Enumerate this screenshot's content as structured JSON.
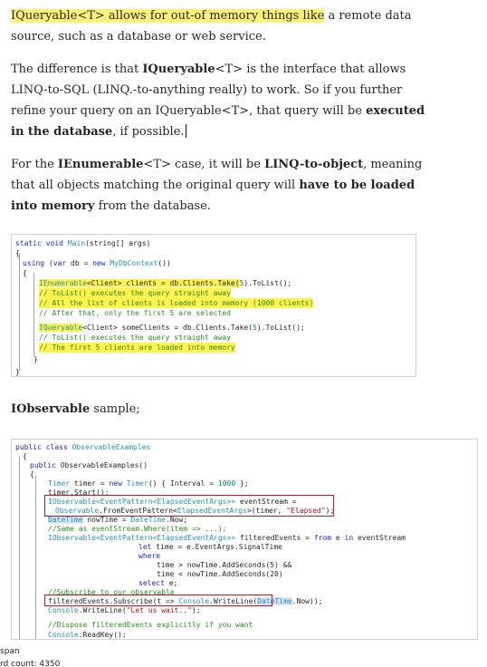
{
  "answer": {
    "p1": {
      "highlight": "IQueryable<T> allows for out-of memory things like",
      "rest": " a remote data source, such as a database or web service."
    },
    "p2": {
      "t1": "The difference is that ",
      "b1": "IQueryable",
      "t2": "<T> is the interface that allows LINQ-to-SQL (LINQ.-to-anything really) to work. So if you further refine your query on an IQueryable<T>, that query will be ",
      "b2": "executed in the database",
      "t3": ", if possible."
    },
    "p3": {
      "t1": "For the ",
      "b1": "IEnumerable",
      "t2": "<T> case, it will be ",
      "b2": "LINQ-to-object",
      "t3": ", meaning that all objects matching the original query will ",
      "b3": "have to be loaded into memory",
      "t4": " from the database."
    },
    "observable_heading_bold": "IObservable",
    "observable_heading_rest": " sample;"
  },
  "code1": {
    "l1_kw": "static void",
    "l1_ty": "Main",
    "l1_rest": "(string[] args)",
    "l2": "{",
    "l3_kw": "using",
    "l3_a": " (",
    "l3_kw2": "var",
    "l3_b": " db = ",
    "l3_kw3": "new",
    "l3_ty": " MyDbContext",
    "l3_c": "())",
    "l4": "{",
    "l5_ty": "IEnumerable",
    "l5_a": "<Client> clients = db.Clients.Take(",
    "l5_num": "5",
    "l5_b": ").ToList();",
    "l6": "// ToList() executes the query straight away",
    "l7": "// All the list of clients is loaded into memory (1000 clients)",
    "l8": "// After that, only the first 5 are selected",
    "l9_ty": "IQueryable",
    "l9_a": "<Client> someClients = db.Clients.Take(",
    "l9_num": "5",
    "l9_b": ").ToList();",
    "l10": "// ToList() executes the query straight away",
    "l11": "// The first 5 clients are loaded into memory",
    "l12": "}",
    "l13": "}"
  },
  "code2": {
    "l1_kw": "public class",
    "l1_ty": " ObservableExamples",
    "l2": "{",
    "l3_kw": "public",
    "l3_rest": " ObservableExamples()",
    "l4": "{",
    "l5_ty": "Timer",
    "l5_a": " timer = ",
    "l5_kw": "new",
    "l5_ty2": " Timer",
    "l5_b": "() { Interval = ",
    "l5_num": "1000",
    "l5_c": " };",
    "l6": "timer.Start();",
    "l7_ty": "IObservable<EventPattern<ElapsedEventArgs>>",
    "l7_rest": " eventStream =",
    "l8_ty": "Observable",
    "l8_a": ".FromEventPattern<",
    "l8_ty2": "ElapsedEventArgs",
    "l8_b": ">(timer, ",
    "l8_st": "\"Elapsed\"",
    "l8_c": ");",
    "l9_ty": "DateTime",
    "l9_a": " nowTime = ",
    "l9_ty2": "DateTime",
    "l9_b": ".Now;",
    "l10": "//Same as eventStream.Where(item => ...);",
    "l11_ty": "IObservable<EventPattern<ElapsedEventArgs>>",
    "l11_a": " filteredEvents = ",
    "l11_kw": "from",
    "l11_b": " e ",
    "l11_kw2": "in",
    "l11_c": " eventStream",
    "l12_kw": "let",
    "l12_rest": " time = e.EventArgs.SignalTime",
    "l13_kw": "where",
    "l14": "time > nowTime.AddSeconds(5) &&",
    "l15": "time < nowTime.AddSeconds(20)",
    "l16_kw": "select",
    "l16_rest": " e;",
    "l17": "//Subscribe to our observable",
    "l18_a": "filteredEvents.Subscribe(t => ",
    "l18_ty": "Console",
    "l18_b": ".WriteLine(",
    "l18_ty2": "DateTime",
    "l18_c": ".Now));",
    "l19_ty": "Console",
    "l19_a": ".WriteLine(",
    "l19_st": "\"Let us wait..\"",
    "l19_b": ");",
    "l20": "//Dispose filteredEvents explicitly if you want",
    "l21_ty": "Console",
    "l21_a": ".ReadKey();"
  },
  "status": {
    "line1": "span",
    "line2": "rd count: 4350"
  }
}
